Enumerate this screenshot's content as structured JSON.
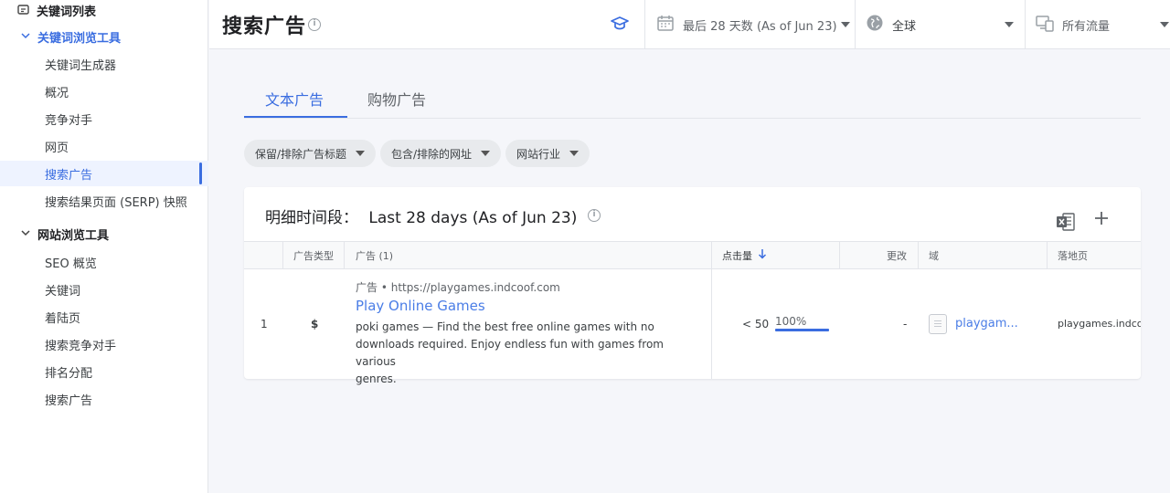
{
  "sidebar": {
    "top_item": "关键词列表",
    "sections": [
      {
        "title": "关键词浏览工具",
        "items": [
          "关键词生成器",
          "概况",
          "竞争对手",
          "网页",
          "搜索广告",
          "搜索结果页面 (SERP) 快照"
        ]
      },
      {
        "title": "网站浏览工具",
        "items": [
          "SEO 概览",
          "关键词",
          "着陆页",
          "搜索竞争对手",
          "排名分配",
          "搜索广告"
        ]
      }
    ],
    "active_item": "搜索广告"
  },
  "header": {
    "title": "搜索广告",
    "date_range": "最后 28 天数 (As of Jun 23)",
    "region": "全球",
    "traffic": "所有流量"
  },
  "tabs": [
    {
      "label": "文本广告",
      "active": true
    },
    {
      "label": "购物广告",
      "active": false
    }
  ],
  "filters": [
    "保留/排除广告标题",
    "包含/排除的网址",
    "网站行业"
  ],
  "card": {
    "title_prefix": "明细时间段：",
    "title_value": "Last 28 days (As of Jun 23)"
  },
  "table": {
    "columns": [
      "广告类型",
      "广告 (1)",
      "点击量",
      "更改",
      "域",
      "落地页"
    ],
    "rows": [
      {
        "index": "1",
        "ad_type": "$",
        "ad_source": "广告 • https://playgames.indcoof.com",
        "ad_title": "Play Online Games",
        "ad_desc_lines": [
          "poki games — Find the best free online games with no",
          "downloads required. Enjoy endless fun with games from various",
          "genres."
        ],
        "clicks": "< 50",
        "clicks_share": "100%",
        "clicks_share_fraction": 1.0,
        "change": "-",
        "domain": "playgam...",
        "landing_page": "playgames.indco"
      }
    ]
  },
  "colors": {
    "accent": "#3a6de0",
    "link": "#4a7de6"
  }
}
